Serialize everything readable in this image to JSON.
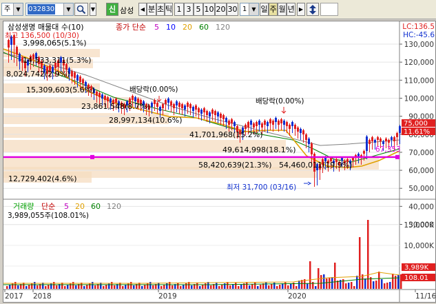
{
  "toolbar": {
    "type_label": "주",
    "code": "032830",
    "search_icon": "magnifier-icon",
    "new_badge": "신",
    "stock_name": "삼성",
    "prev_label": "◀",
    "tick_label": "분",
    "tick2_label": "초",
    "tick3_label": "틱",
    "intervals": [
      "1",
      "3",
      "5",
      "10",
      "20",
      "30"
    ],
    "interval_value": "1",
    "periods": [
      "일",
      "주",
      "월",
      "년"
    ],
    "active_period": "주",
    "next_label": "▶",
    "updown_icon": "up-down-arrow-icon"
  },
  "chart": {
    "title": "삼성생명 매물대 수(10)",
    "ma_label": "종가 단순",
    "ma_periods": [
      "5",
      "10",
      "20",
      "60",
      "120"
    ],
    "ma_colors": [
      "#c000c0",
      "#0000ff",
      "#e0a000",
      "#008000",
      "#808080"
    ],
    "lc_label": "LC:136.5",
    "hc_label": "HC:-45.6",
    "price_ticks": [
      "130,000",
      "120,000",
      "110,000",
      "100,000",
      "90,000",
      "80,000",
      "70,000",
      "60,000",
      "50,000",
      "40,000",
      "30,000"
    ],
    "current_price_tag": "75,000",
    "current_pct_tag": "11.61%",
    "horizontal_line_value": "67,353",
    "high_label": "최고 136,500 (10/30)",
    "low_label": "최저 31,700 (03/16)",
    "dividend_labels": [
      "배당락(0.00%)",
      "배당락(0.00%)"
    ],
    "volume_profile": [
      "3,998,065(5.1%)",
      "14,533,311(5.3%)",
      "8,024,742(2.9%)",
      "15,309,603(5.6%)",
      "23,861,548(8.7%)",
      "28,997,134(10.6%)",
      "41,701,968(15.2%)",
      "49,614,998(18.1%)",
      "58,420,639(21.3%)",
      "54,460,011(19.9%)",
      "12,729,402(4.6%)"
    ],
    "volume_title": "거래량",
    "volume_ma_label": "단순",
    "volume_ma_periods": [
      "5",
      "20",
      "60",
      "120"
    ],
    "volume_value": "3,989,055주(108.01%)",
    "volume_ticks": [
      "15,000K",
      "10,000K",
      "5,000K"
    ],
    "volume_tag": "3,989K",
    "volume_pct_tag": "108.01",
    "x_labels": [
      "2017",
      "2018",
      "2019",
      "2020",
      "11/16"
    ]
  }
}
